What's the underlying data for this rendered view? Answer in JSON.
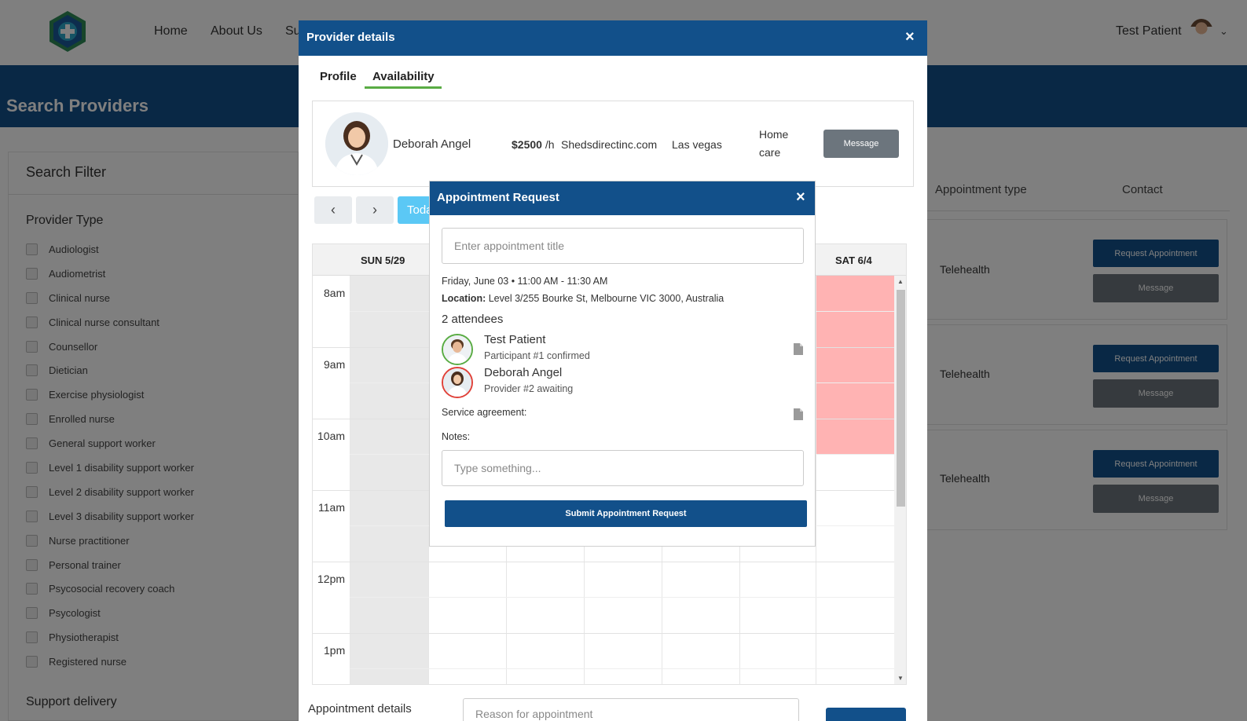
{
  "navbar": {
    "links": [
      "Home",
      "About Us",
      "Su"
    ],
    "user_name": "Test Patient"
  },
  "banner": {
    "title": "Search Providers"
  },
  "filter": {
    "title": "Search Filter",
    "provider_type_label": "Provider Type",
    "provider_types": [
      "Audiologist",
      "Audiometrist",
      "Clinical nurse",
      "Clinical nurse consultant",
      "Counsellor",
      "Dietician",
      "Exercise physiologist",
      "Enrolled nurse",
      "General support worker",
      "Level 1 disability support worker",
      "Level 2 disability support worker",
      "Level 3 disability support worker",
      "Nurse practitioner",
      "Personal trainer",
      "Psycosocial recovery coach",
      "Psycologist",
      "Physiotherapist",
      "Registered nurse"
    ],
    "support_delivery_label": "Support delivery"
  },
  "results": {
    "header_type": "Appointment type",
    "header_contact": "Contact",
    "rows": [
      {
        "type": "Telehealth",
        "request_label": "Request Appointment",
        "message_label": "Message"
      },
      {
        "type": "Telehealth",
        "request_label": "Request Appointment",
        "message_label": "Message"
      },
      {
        "type": "Telehealth",
        "request_label": "Request Appointment",
        "message_label": "Message"
      }
    ]
  },
  "provider_modal": {
    "title": "Provider details",
    "close_icon": "×",
    "tabs": {
      "profile": "Profile",
      "availability": "Availability"
    },
    "provider": {
      "name": "Deborah Angel",
      "rate": "$2500",
      "rate_unit": "/h",
      "website": "Shedsdirectinc.com",
      "city": "Las vegas",
      "service": "Home care",
      "message_label": "Message"
    },
    "calendar": {
      "prev_icon": "‹",
      "next_icon": "›",
      "today_label": "Toda",
      "days": [
        "SUN 5/29",
        "SAT 6/4"
      ],
      "times": [
        "8am",
        "9am",
        "10am",
        "11am",
        "12pm",
        "1pm"
      ]
    },
    "appt_details_label": "Appointment details",
    "reason_placeholder": "Reason for appointment"
  },
  "appt_modal": {
    "title": "Appointment Request",
    "close_icon": "×",
    "title_placeholder": "Enter appointment title",
    "when": "Friday, June 03  •  11:00 AM - 11:30 AM",
    "location_label": "Location:",
    "location": "Level 3/255 Bourke St, Melbourne VIC 3000, Australia",
    "attendee_count": "2 attendees",
    "attendees": [
      {
        "name": "Test Patient",
        "status": "Participant #1 confirmed",
        "status_color": "#5aac44"
      },
      {
        "name": "Deborah Angel",
        "status": "Provider #2 awaiting",
        "status_color": "#e0423a"
      }
    ],
    "service_agreement_label": "Service agreement:",
    "notes_label": "Notes:",
    "notes_placeholder": "Type something...",
    "submit_label": "Submit Appointment Request"
  },
  "colors": {
    "brand_blue": "#12508a",
    "accent_green": "#5aac44",
    "today_blue": "#5bc8f5",
    "busy_red": "#ffb3b3"
  },
  "icons": [
    "logo-icon",
    "chevron-down-icon",
    "close-icon",
    "chevron-left-icon",
    "chevron-right-icon",
    "document-icon"
  ]
}
